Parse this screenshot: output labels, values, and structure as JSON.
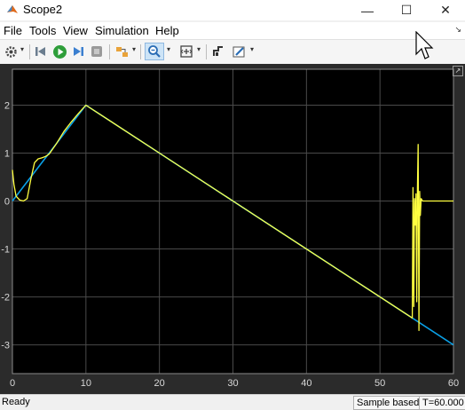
{
  "window": {
    "title": "Scope2",
    "controls": {
      "minimize": "—",
      "maximize": "☐",
      "close": "✕"
    }
  },
  "menu": {
    "items": [
      "File",
      "Tools",
      "View",
      "Simulation",
      "Help"
    ]
  },
  "toolbar": {
    "icons": [
      "gear-icon",
      "step-back-icon",
      "run-icon",
      "step-forward-icon",
      "stop-icon",
      "highlight-block-icon",
      "zoom-in-icon",
      "zoom-fit-icon",
      "cursor-measure-icon",
      "style-icon"
    ],
    "active": "zoom-in-icon"
  },
  "status": {
    "state": "Ready",
    "sample_mode": "Sample based",
    "time": "T=60.000"
  },
  "colors": {
    "plot_bg": "#000000",
    "frame_bg": "#2b2b2b",
    "grid": "#4a4a4a",
    "axis_text": "#d9d9d9",
    "series_1": "#ffff40",
    "series_2": "#0aa0e6"
  },
  "chart_data": {
    "type": "line",
    "title": "",
    "xlabel": "",
    "ylabel": "",
    "xlim": [
      0,
      60
    ],
    "ylim": [
      -3.6,
      2.75
    ],
    "xticks": [
      0,
      10,
      20,
      30,
      40,
      50,
      60
    ],
    "yticks": [
      2,
      1,
      0,
      -1,
      -2,
      -3
    ],
    "grid": true,
    "legend": "none",
    "series": [
      {
        "color": "#0aa0e6",
        "x": [
          0,
          10,
          60
        ],
        "y": [
          0,
          2,
          -3
        ]
      },
      {
        "color": "#ffff40",
        "x": [
          0,
          0.2,
          0.5,
          1,
          1.5,
          2,
          2.5,
          3,
          3.5,
          4,
          4.5,
          5,
          6,
          7,
          8,
          9,
          10,
          20,
          30,
          40,
          50,
          54.4,
          54.5,
          54.6,
          54.7,
          54.8,
          54.9,
          55.0,
          55.1,
          55.2,
          55.3,
          55.4,
          55.5,
          55.6,
          55.8,
          56,
          58,
          60
        ],
        "y": [
          0.65,
          0.35,
          0.1,
          0.02,
          0.0,
          0.05,
          0.45,
          0.8,
          0.88,
          0.9,
          0.93,
          0.98,
          1.2,
          1.45,
          1.65,
          1.83,
          2,
          1,
          0,
          -1,
          -2,
          -2.44,
          0.28,
          -2.2,
          0.05,
          -0.5,
          0.15,
          -2.1,
          0.25,
          1.18,
          -2.7,
          0.2,
          -0.3,
          0.05,
          0.0,
          0.0,
          0.0,
          0.0
        ]
      }
    ]
  }
}
